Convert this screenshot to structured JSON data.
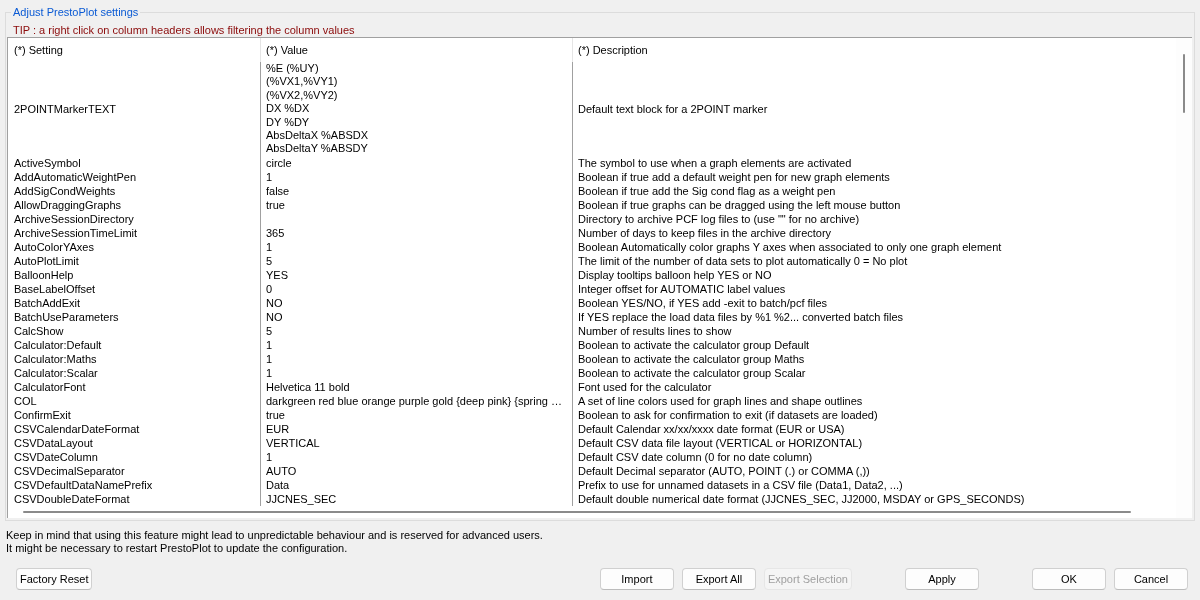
{
  "group_box": {
    "title": "Adjust PrestoPlot settings"
  },
  "tip": "TIP : a right click on column headers allows filtering the column values",
  "table": {
    "columns": [
      "(*) Setting",
      "(*) Value",
      "(*) Description"
    ],
    "rows": [
      {
        "setting": "2POINTMarkerTEXT",
        "value": "%E (%UY)\n(%VX1,%VY1)\n(%VX2,%VY2)\nDX %DX\nDY %DY\nAbsDeltaX %ABSDX\nAbsDeltaY %ABSDY",
        "description": "Default text block for a 2POINT marker"
      },
      {
        "setting": "ActiveSymbol",
        "value": "circle",
        "description": "The symbol to use when a graph elements are activated"
      },
      {
        "setting": "AddAutomaticWeightPen",
        "value": "1",
        "description": "Boolean if true add a default weight pen for new graph elements"
      },
      {
        "setting": "AddSigCondWeights",
        "value": "false",
        "description": "Boolean if true add the Sig cond flag as a weight pen"
      },
      {
        "setting": "AllowDraggingGraphs",
        "value": "true",
        "description": "Boolean if true graphs can be dragged using the left mouse button"
      },
      {
        "setting": "ArchiveSessionDirectory",
        "description": "Directory to archive PCF log files to (use \"\" for no archive)"
      },
      {
        "setting": "ArchiveSessionTimeLimit",
        "value": "365",
        "description": "Number of days to keep files in the archive directory"
      },
      {
        "setting": "AutoColorYAxes",
        "value": "1",
        "description": "Boolean Automatically color graphs Y axes when associated to only one graph element"
      },
      {
        "setting": "AutoPlotLimit",
        "value": "5",
        "description": "The limit of the number of data sets to plot automatically 0 = No plot"
      },
      {
        "setting": "BalloonHelp",
        "value": "YES",
        "description": "Display tooltips balloon help YES or NO"
      },
      {
        "setting": "BaseLabelOffset",
        "value": "0",
        "description": "Integer offset for AUTOMATIC label values"
      },
      {
        "setting": "BatchAddExit",
        "value": "NO",
        "description": "Boolean YES/NO, if YES add -exit to batch/pcf files"
      },
      {
        "setting": "BatchUseParameters",
        "value": "NO",
        "description": "If YES replace the load data files by %1 %2... converted batch files"
      },
      {
        "setting": "CalcShow",
        "value": "5",
        "description": "Number of results lines to show"
      },
      {
        "setting": "Calculator:Default",
        "value": "1",
        "description": "Boolean to activate the calculator group Default"
      },
      {
        "setting": "Calculator:Maths",
        "value": "1",
        "description": "Boolean to activate the calculator group Maths"
      },
      {
        "setting": "Calculator:Scalar",
        "value": "1",
        "description": "Boolean to activate the calculator group Scalar"
      },
      {
        "setting": "CalculatorFont",
        "value": "Helvetica 11 bold",
        "description": "Font used for the calculator"
      },
      {
        "setting": "COL",
        "value": "darkgreen red blue orange purple gold {deep pink} {spring …",
        "description": "A set of line colors used for graph lines and shape outlines"
      },
      {
        "setting": "ConfirmExit",
        "value": "true",
        "description": "Boolean to ask for confirmation to exit (if datasets are loaded)"
      },
      {
        "setting": "CSVCalendarDateFormat",
        "value": "EUR",
        "description": "Default Calendar xx/xx/xxxx date format (EUR or USA)"
      },
      {
        "setting": "CSVDataLayout",
        "value": "VERTICAL",
        "description": "Default CSV data file layout (VERTICAL or HORIZONTAL)"
      },
      {
        "setting": "CSVDateColumn",
        "value": "1",
        "description": "Default CSV date column (0 for no date column)"
      },
      {
        "setting": "CSVDecimalSeparator",
        "value": "AUTO",
        "description": "Default Decimal separator (AUTO, POINT (.) or COMMA (,))"
      },
      {
        "setting": "CSVDefaultDataNamePrefix",
        "value": "Data",
        "description": "Prefix to use for unnamed datasets in a CSV file (Data1, Data2, ...)"
      },
      {
        "setting": "CSVDoubleDateFormat",
        "value": "JJCNES_SEC",
        "description": "Default double numerical date format (JJCNES_SEC, JJ2000, MSDAY or GPS_SECONDS)"
      }
    ]
  },
  "notes": [
    "Keep in mind that using this feature might lead to unpredictable behaviour and is reserved for advanced users.",
    "It might be necessary to restart PrestoPlot to update the configuration."
  ],
  "button_groups": [
    [
      {
        "label": "Factory Reset",
        "disabled": false
      }
    ],
    [
      {
        "label": "Import",
        "disabled": false
      },
      {
        "label": "Export All",
        "disabled": false
      },
      {
        "label": "Export Selection",
        "disabled": true
      }
    ],
    [
      {
        "label": "Apply",
        "disabled": false
      }
    ],
    [
      {
        "label": "OK",
        "disabled": false
      },
      {
        "label": "Cancel",
        "disabled": false
      }
    ]
  ]
}
